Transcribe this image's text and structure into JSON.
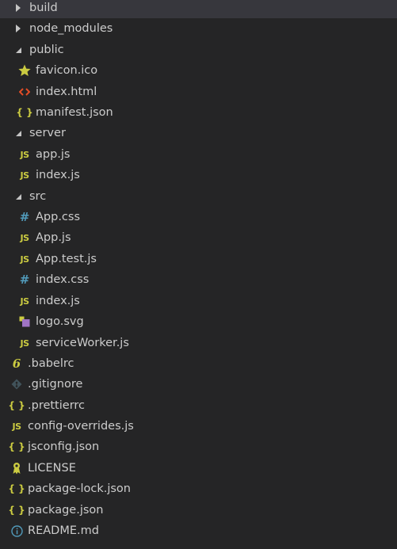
{
  "explorer": {
    "items": [
      {
        "name": "build",
        "type": "folder",
        "expanded": false,
        "depth": 0,
        "icon": "chevron-right-icon"
      },
      {
        "name": "node_modules",
        "type": "folder",
        "expanded": false,
        "depth": 0,
        "icon": "chevron-right-icon"
      },
      {
        "name": "public",
        "type": "folder",
        "expanded": true,
        "depth": 0,
        "icon": "chevron-down-icon"
      },
      {
        "name": "favicon.ico",
        "type": "file",
        "depth": 1,
        "icon": "star-icon"
      },
      {
        "name": "index.html",
        "type": "file",
        "depth": 1,
        "icon": "html-icon"
      },
      {
        "name": "manifest.json",
        "type": "file",
        "depth": 1,
        "icon": "json-braces-icon"
      },
      {
        "name": "server",
        "type": "folder",
        "expanded": true,
        "depth": 0,
        "icon": "chevron-down-icon"
      },
      {
        "name": "app.js",
        "type": "file",
        "depth": 1,
        "icon": "js-icon"
      },
      {
        "name": "index.js",
        "type": "file",
        "depth": 1,
        "icon": "js-icon"
      },
      {
        "name": "src",
        "type": "folder",
        "expanded": true,
        "depth": 0,
        "icon": "chevron-down-icon"
      },
      {
        "name": "App.css",
        "type": "file",
        "depth": 1,
        "icon": "css-hash-icon"
      },
      {
        "name": "App.js",
        "type": "file",
        "depth": 1,
        "icon": "js-icon"
      },
      {
        "name": "App.test.js",
        "type": "file",
        "depth": 1,
        "icon": "js-icon"
      },
      {
        "name": "index.css",
        "type": "file",
        "depth": 1,
        "icon": "css-hash-icon"
      },
      {
        "name": "index.js",
        "type": "file",
        "depth": 1,
        "icon": "js-icon"
      },
      {
        "name": "logo.svg",
        "type": "file",
        "depth": 1,
        "icon": "svg-icon"
      },
      {
        "name": "serviceWorker.js",
        "type": "file",
        "depth": 1,
        "icon": "js-icon"
      },
      {
        "name": ".babelrc",
        "type": "file",
        "depth": 0,
        "icon": "babel-icon"
      },
      {
        "name": ".gitignore",
        "type": "file",
        "depth": 0,
        "icon": "git-icon"
      },
      {
        "name": ".prettierrc",
        "type": "file",
        "depth": 0,
        "icon": "json-braces-icon"
      },
      {
        "name": "config-overrides.js",
        "type": "file",
        "depth": 0,
        "icon": "js-icon"
      },
      {
        "name": "jsconfig.json",
        "type": "file",
        "depth": 0,
        "icon": "json-braces-icon"
      },
      {
        "name": "LICENSE",
        "type": "file",
        "depth": 0,
        "icon": "license-icon"
      },
      {
        "name": "package-lock.json",
        "type": "file",
        "depth": 0,
        "icon": "json-braces-icon"
      },
      {
        "name": "package.json",
        "type": "file",
        "depth": 0,
        "icon": "json-braces-icon"
      },
      {
        "name": "README.md",
        "type": "file",
        "depth": 0,
        "icon": "info-icon"
      }
    ],
    "colors": {
      "background": "#252526",
      "selected": "#37373d",
      "text": "#cccccc",
      "js_yellow": "#cbcb41",
      "css_blue": "#519aba",
      "html_orange": "#e44d26",
      "svg_purple": "#a074c4",
      "git_gray": "#41535b"
    }
  }
}
